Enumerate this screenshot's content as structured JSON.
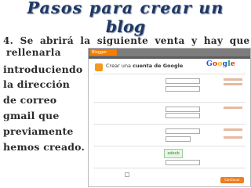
{
  "title": {
    "line1": "Pasos para crear un",
    "line2": "blog"
  },
  "instruction": {
    "line1": "4.  Se abrirá la siguiente venta y hay que",
    "line2": "rellenarla",
    "left_lines": [
      "introduciendo",
      " la dirección",
      "de correo",
      "gmail que",
      "previamente",
      "hemos creado."
    ]
  },
  "screenshot": {
    "heading_prefix": "Crear una",
    "heading_bold": "cuenta de Google",
    "logo": "Google",
    "app_label": "Blogger",
    "captcha_word": "adexb",
    "continue_label": "Continuar",
    "accent_color": "#f57d00"
  }
}
